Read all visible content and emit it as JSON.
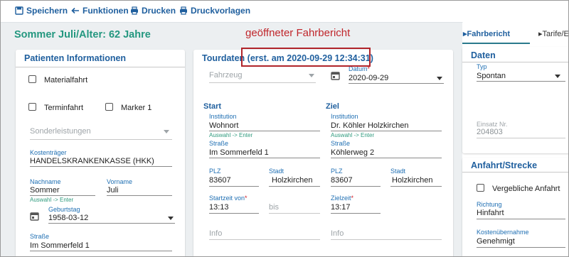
{
  "toolbar": {
    "save": "Speichern",
    "functions": "Funktionen",
    "print": "Drucken",
    "print_templates": "Druckvorlagen"
  },
  "patient_title": "Sommer Juli/Alter: 62 Jahre",
  "annotation": "geöffneter Fahrbericht",
  "patient": {
    "title": "Patienten Informationen",
    "material_trip": "Materialfahrt",
    "appointment_trip": "Terminfahrt",
    "marker": "Marker 1",
    "extra_services_placeholder": "Sonderleistungen",
    "payer_label": "Kostenträger",
    "payer_value": "HANDELSKRANKENKASSE (HKK)",
    "lastname_label": "Nachname",
    "lastname_value": "Sommer",
    "lastname_hint": "Auswahl -> Enter",
    "firstname_label": "Vorname",
    "firstname_value": "Juli",
    "birthday_label": "Geburtstag",
    "birthday_value": "1958-03-12",
    "street_label": "Straße",
    "street_value": "Im Sommerfeld 1"
  },
  "tour": {
    "title": "Tourdaten",
    "created": "(erst. am 2020-09-29 12:34:31)",
    "vehicle_placeholder": "Fahrzeug",
    "date_label": "Datum",
    "date_required": "*",
    "date_value": "2020-09-29",
    "start": {
      "heading": "Start",
      "institution_label": "Institution",
      "institution_value": "Wohnort",
      "hint": "Auswahl -> Enter",
      "street_label": "Straße",
      "street_value": "Im Sommerfeld 1",
      "zip_label": "PLZ",
      "zip_value": "83607",
      "city_label": "Stadt",
      "city_value": "Holzkirchen",
      "time_label": "Startzeit von",
      "time_required": "*",
      "time_value": "13:13",
      "until_placeholder": "bis",
      "info_placeholder": "Info"
    },
    "goal": {
      "heading": "Ziel",
      "institution_label": "Institution",
      "institution_value": "Dr. Köhler Holzkirchen",
      "hint": "Auswahl -> Enter",
      "street_label": "Straße",
      "street_value": "Köhlerweg 2",
      "zip_label": "PLZ",
      "zip_value": "83607",
      "city_label": "Stadt",
      "city_value": "Holzkirchen",
      "time_label": "Zielzeit",
      "time_required": "*",
      "time_value": "13:17",
      "info_placeholder": "Info"
    }
  },
  "tabs": {
    "trip_report": "Fahrbericht",
    "tariffs": "Tarife/E"
  },
  "data_panel": {
    "title": "Daten",
    "type_label": "Typ",
    "type_value": "Spontan",
    "mission_label": "Einsatz Nr.",
    "mission_value": "204803"
  },
  "route_panel": {
    "title": "Anfahrt/Strecke",
    "futile_trip": "Vergebliche Anfahrt",
    "direction_label": "Richtung",
    "direction_value": "Hinfahrt",
    "coverage_label": "Kostenübernahme",
    "coverage_value": "Genehmigt"
  },
  "colors": {
    "accent_blue": "#1f5f9e",
    "patient_green": "#23977f",
    "annotation_red": "#c0262b",
    "hint_green": "#2e9a7d"
  }
}
